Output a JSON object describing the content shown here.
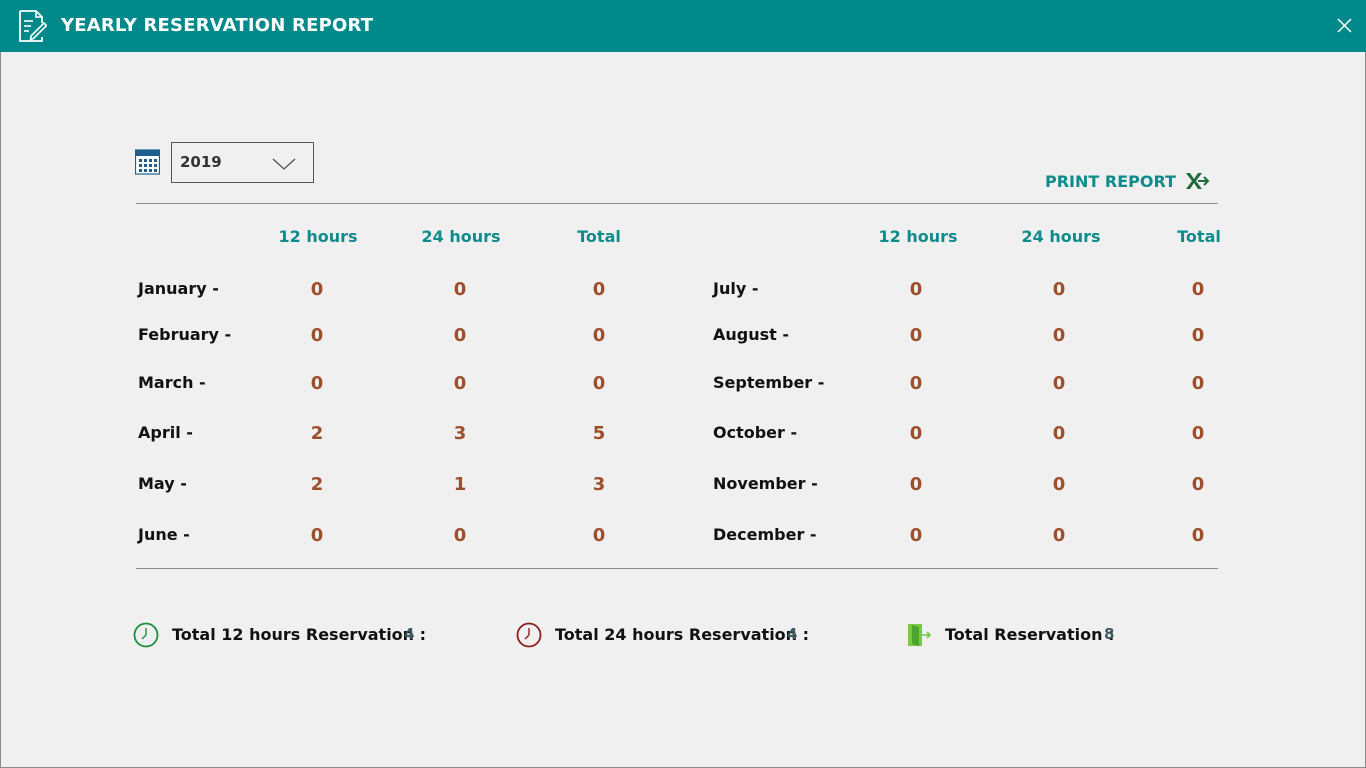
{
  "window": {
    "title": "YEARLY RESERVATION REPORT",
    "brand_color": "#00898a",
    "icons": {
      "title": "report-edit-icon",
      "close": "close-icon"
    }
  },
  "filter": {
    "year": "2019",
    "icon": "calendar-icon",
    "dropdown_icon": "chevron-down-icon"
  },
  "actions": {
    "print_label": "PRINT REPORT",
    "export_icon": "excel-export-icon"
  },
  "table": {
    "headers": [
      "12 hours",
      "24 hours",
      "Total"
    ],
    "left": [
      {
        "month": "January -",
        "h12": "0",
        "h24": "0",
        "total": "0"
      },
      {
        "month": "February -",
        "h12": "0",
        "h24": "0",
        "total": "0"
      },
      {
        "month": "March -",
        "h12": "0",
        "h24": "0",
        "total": "0"
      },
      {
        "month": "April -",
        "h12": "2",
        "h24": "3",
        "total": "5"
      },
      {
        "month": "May -",
        "h12": "2",
        "h24": "1",
        "total": "3"
      },
      {
        "month": "June -",
        "h12": "0",
        "h24": "0",
        "total": "0"
      }
    ],
    "right": [
      {
        "month": "July -",
        "h12": "0",
        "h24": "0",
        "total": "0"
      },
      {
        "month": "August -",
        "h12": "0",
        "h24": "0",
        "total": "0"
      },
      {
        "month": "September -",
        "h12": "0",
        "h24": "0",
        "total": "0"
      },
      {
        "month": "October -",
        "h12": "0",
        "h24": "0",
        "total": "0"
      },
      {
        "month": "November -",
        "h12": "0",
        "h24": "0",
        "total": "0"
      },
      {
        "month": "December -",
        "h12": "0",
        "h24": "0",
        "total": "0"
      }
    ],
    "value_color": "#9c4f2a",
    "header_color": "#0e8c8c"
  },
  "summary": {
    "h12_label": "Total 12 hours Reservation :",
    "h12_value": "4",
    "h12_icon": "green-clock-icon",
    "h24_label": "Total 24 hours Reservation :",
    "h24_value": "4",
    "h24_icon": "red-clock-icon",
    "total_label": "Total Reservation :",
    "total_value": "8",
    "total_icon": "door-exit-icon"
  }
}
